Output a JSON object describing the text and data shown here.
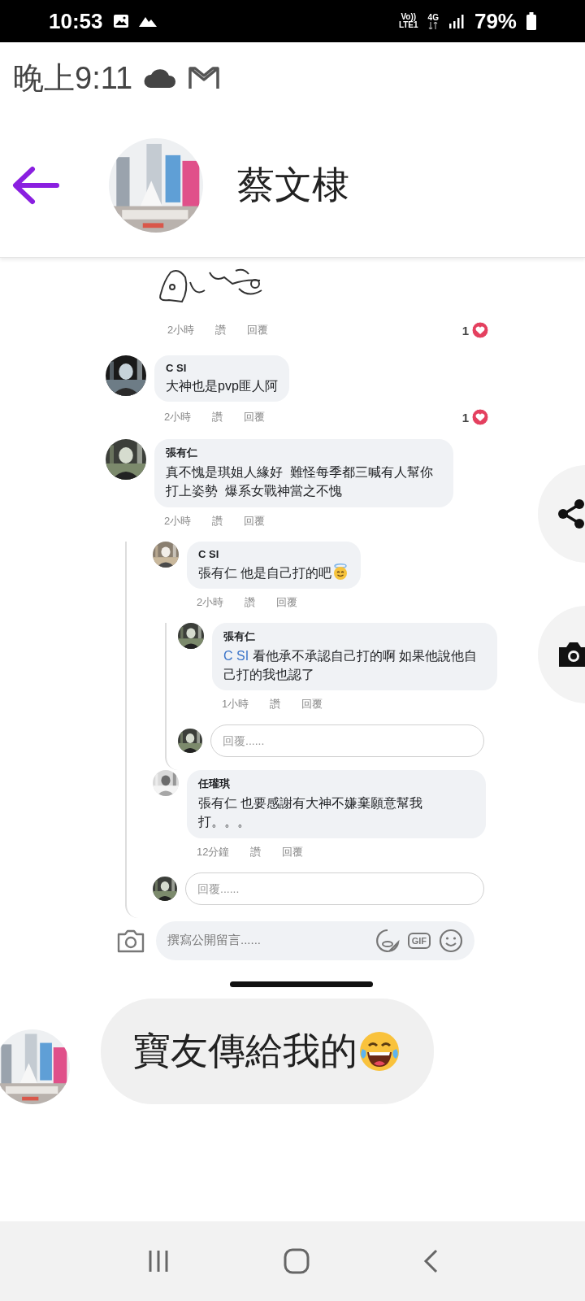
{
  "status_bar": {
    "time": "10:53",
    "volte": "Vo))",
    "lte": "LTE1",
    "network": "4G",
    "battery": "79%"
  },
  "notification": {
    "time": "晚上9:11"
  },
  "chat_header": {
    "name": "蔡文棣"
  },
  "shared_screenshot": {
    "sticker_meta": {
      "time": "2小時",
      "like": "讚",
      "reply": "回覆",
      "reactions": "1"
    },
    "comments": [
      {
        "author": "C SI",
        "text": "大神也是pvp匪人阿",
        "time": "2小時",
        "like": "讚",
        "reply": "回覆",
        "reactions": "1"
      },
      {
        "author": "張有仁",
        "text": "真不愧是琪姐人緣好  難怪每季都三喊有人幫你打上姿勢  爆系女戰神當之不愧",
        "time": "2小時",
        "like": "讚",
        "reply": "回覆",
        "children": [
          {
            "author": "C SI",
            "text": "張有仁 他是自己打的吧",
            "emoji": true,
            "time": "2小時",
            "like": "讚",
            "reply": "回覆",
            "children": [
              {
                "author": "張有仁",
                "mention": "C SI",
                "text": "看他承不承認自己打的啊 如果他說他自己打的我也認了",
                "time": "1小時",
                "like": "讚",
                "reply": "回覆"
              }
            ],
            "reply_box": {
              "placeholder": "回覆......"
            }
          },
          {
            "author": "任瓘琪",
            "text": "張有仁 也要感謝有大神不嫌棄願意幫我打。。。",
            "time": "12分鐘",
            "like": "讚",
            "reply": "回覆"
          }
        ],
        "reply_box": {
          "placeholder": "回覆......"
        }
      }
    ],
    "composer": {
      "placeholder": "撰寫公開留言......",
      "gif_label": "GIF"
    }
  },
  "messages": [
    {
      "text": "寶友傳給我的",
      "emoji": true
    }
  ]
}
